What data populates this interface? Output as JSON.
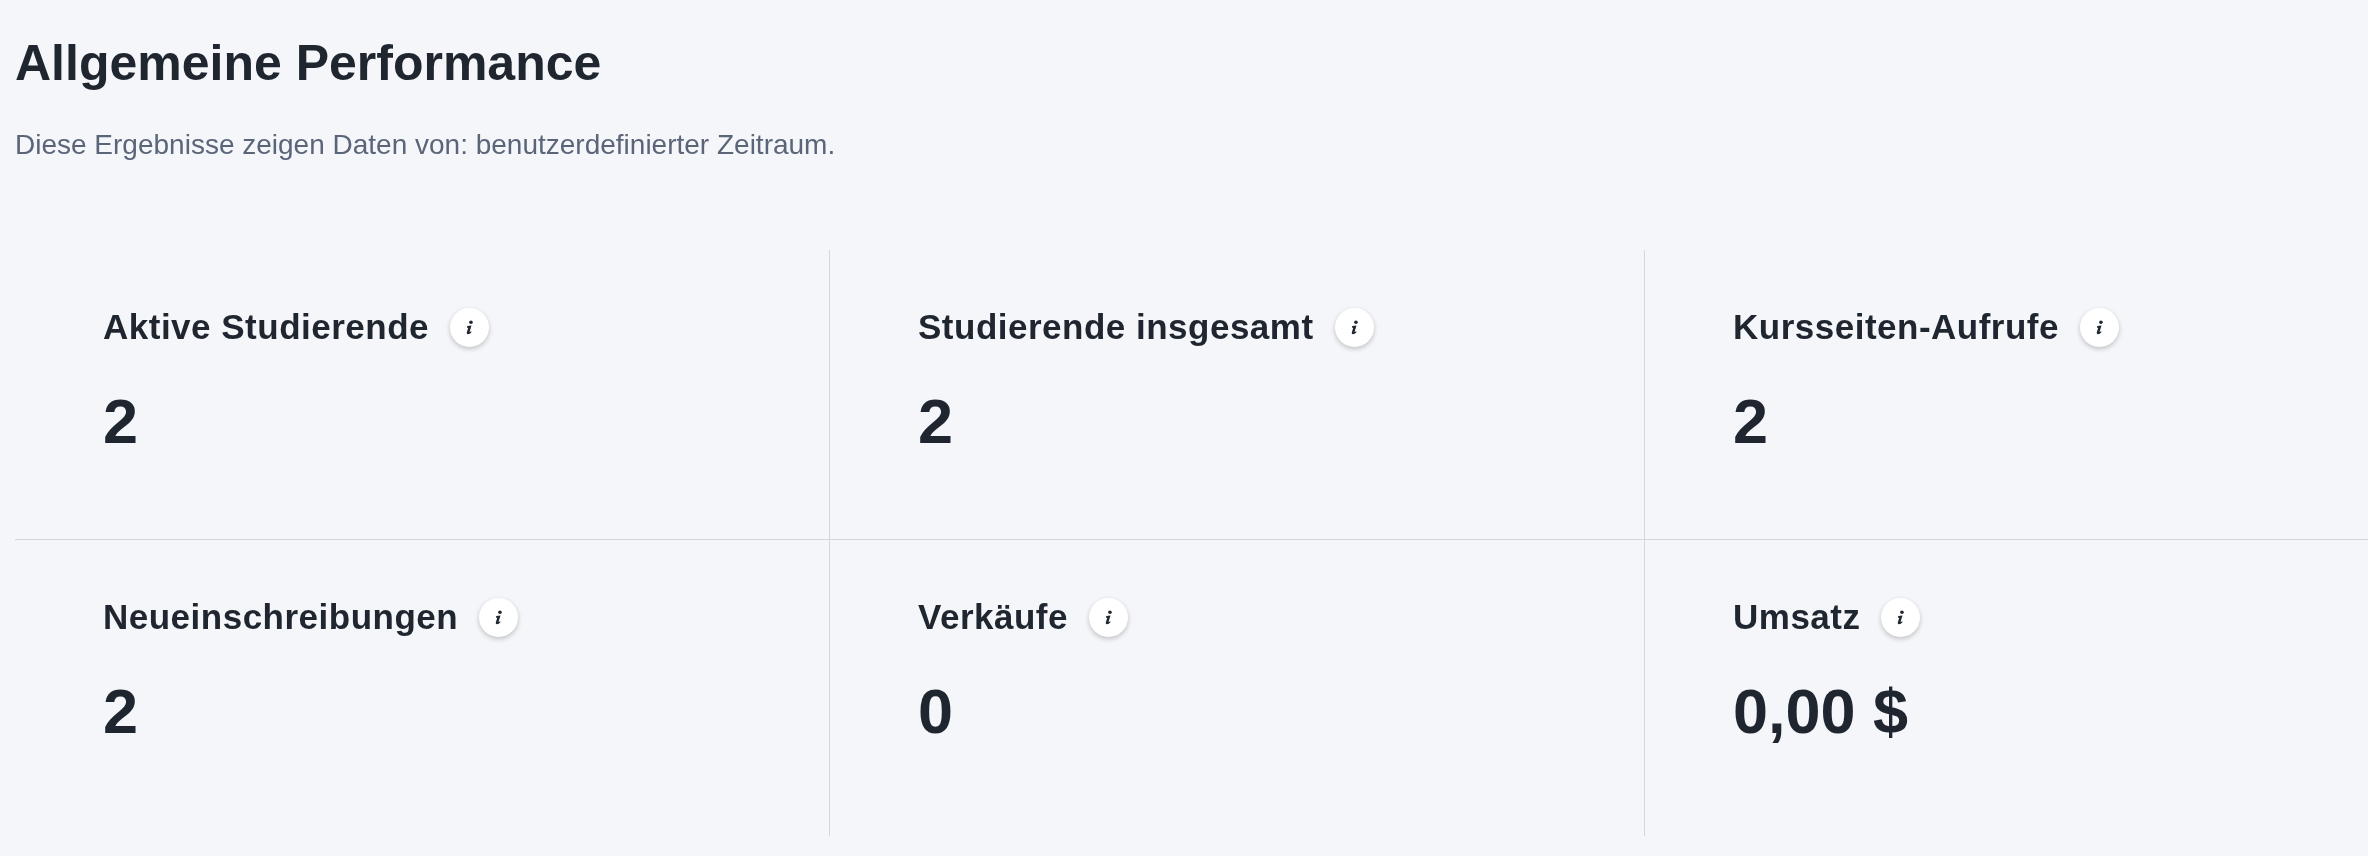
{
  "header": {
    "title": "Allgemeine Performance",
    "subtitle": "Diese Ergebnisse zeigen Daten von: benutzerdefinierter Zeitraum."
  },
  "metrics": [
    {
      "label": "Aktive Studierende",
      "value": "2"
    },
    {
      "label": "Studierende insgesamt",
      "value": "2"
    },
    {
      "label": "Kursseiten-Aufrufe",
      "value": "2"
    },
    {
      "label": "Neueinschreibungen",
      "value": "2"
    },
    {
      "label": "Verkäufe",
      "value": "0"
    },
    {
      "label": "Umsatz",
      "value": "0,00 $"
    }
  ]
}
